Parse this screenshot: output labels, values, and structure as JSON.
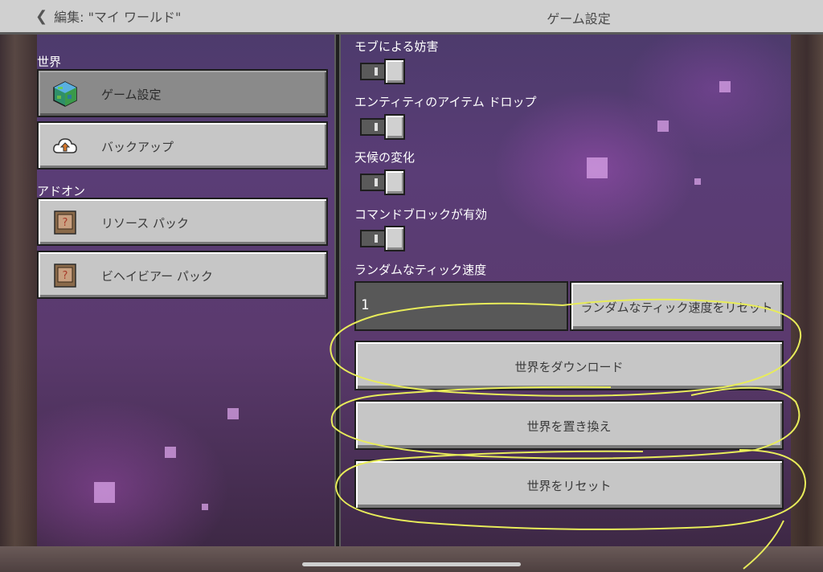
{
  "header": {
    "back_label": "編集: \"マイ ワールド\"",
    "title": "ゲーム設定"
  },
  "sidebar": {
    "sections": [
      {
        "label": "世界",
        "items": [
          {
            "label": "ゲーム設定",
            "icon": "world-globe-icon",
            "selected": true
          },
          {
            "label": "バックアップ",
            "icon": "cloud-upload-icon",
            "selected": false
          }
        ]
      },
      {
        "label": "アドオン",
        "items": [
          {
            "label": "リソース パック",
            "icon": "pack-icon",
            "selected": false
          },
          {
            "label": "ビヘイビアー パック",
            "icon": "pack-icon",
            "selected": false
          }
        ]
      }
    ]
  },
  "settings": {
    "toggles": [
      {
        "label": "モブによる妨害"
      },
      {
        "label": "エンティティのアイテム ドロップ"
      },
      {
        "label": "天候の変化"
      },
      {
        "label": "コマンドブロックが有効"
      }
    ],
    "random_tick": {
      "label": "ランダムなティック速度",
      "value": "1",
      "reset_label": "ランダムなティック速度をリセット"
    },
    "actions": {
      "download": "世界をダウンロード",
      "replace": "世界を置き換え",
      "reset": "世界をリセット"
    }
  },
  "colors": {
    "button_face": "#c6c6c6",
    "annotation": "#e8ec5a"
  }
}
